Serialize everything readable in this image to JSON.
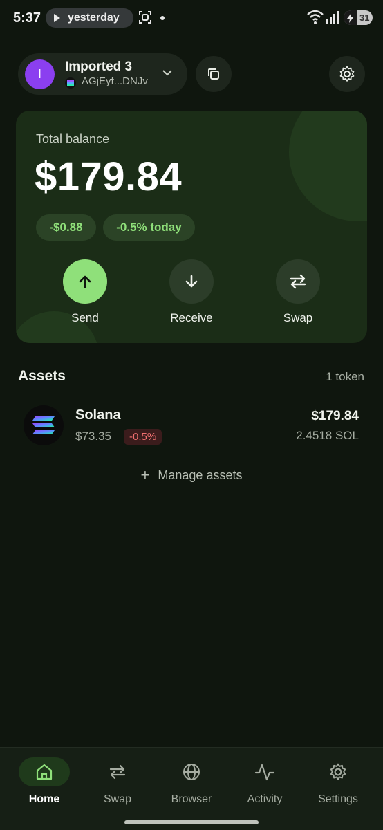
{
  "status_bar": {
    "time": "5:37",
    "media_label": "yesterday",
    "battery_level": "31"
  },
  "account": {
    "avatar_initial": "I",
    "name": "Imported 3",
    "address": "AGjEyf...DNJv",
    "avatar_color": "#8b3ff0"
  },
  "balance": {
    "label": "Total balance",
    "amount": "$179.84",
    "change_amount": "-$0.88",
    "change_percent": "-0.5% today"
  },
  "actions": {
    "send": "Send",
    "receive": "Receive",
    "swap": "Swap"
  },
  "assets": {
    "title": "Assets",
    "count": "1 token",
    "items": [
      {
        "name": "Solana",
        "price": "$73.35",
        "change": "-0.5%",
        "value": "$179.84",
        "amount": "2.4518 SOL",
        "icon": "solana-icon"
      }
    ],
    "manage_label": "Manage assets"
  },
  "nav": {
    "items": [
      {
        "label": "Home",
        "icon": "home-icon",
        "active": true
      },
      {
        "label": "Swap",
        "icon": "swap-icon",
        "active": false
      },
      {
        "label": "Browser",
        "icon": "globe-icon",
        "active": false
      },
      {
        "label": "Activity",
        "icon": "activity-icon",
        "active": false
      },
      {
        "label": "Settings",
        "icon": "gear-icon",
        "active": false
      }
    ]
  },
  "colors": {
    "background": "#0f160e",
    "card": "#1b2d17",
    "accent": "#8fe07a",
    "negative": "#f07070"
  }
}
